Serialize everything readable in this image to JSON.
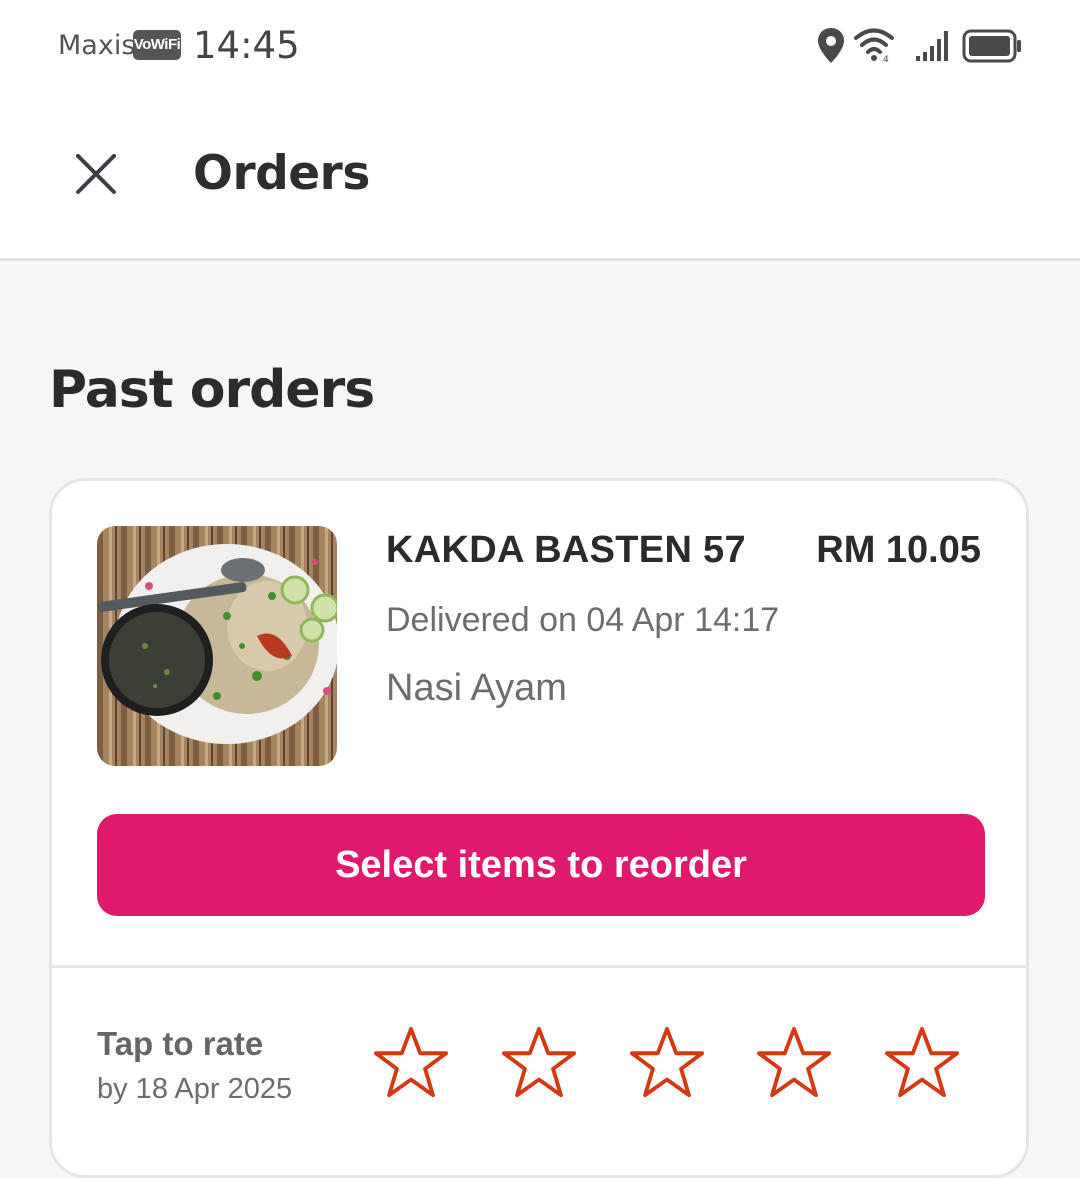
{
  "status_bar": {
    "carrier": "Maxis",
    "vowifi": "VoWiFi",
    "time": "14:45",
    "icons": [
      "location-icon",
      "wifi-icon",
      "signal-icon",
      "battery-icon"
    ]
  },
  "header": {
    "title": "Orders",
    "close_icon": "close-icon"
  },
  "section": {
    "title": "Past orders"
  },
  "order": {
    "vendor": "KAKDA BASTEN 57",
    "price": "RM 10.05",
    "delivered": "Delivered on 04 Apr 14:17",
    "items": "Nasi Ayam",
    "reorder_label": "Select items to reorder"
  },
  "rating": {
    "title": "Tap to rate",
    "deadline": "by 18 Apr 2025",
    "max_stars": 5,
    "selected_stars": 0,
    "star_icon": "star-outline-icon"
  },
  "colors": {
    "accent": "#e0196d",
    "star_outline": "#d43a12",
    "background": "#f6f6f6"
  }
}
